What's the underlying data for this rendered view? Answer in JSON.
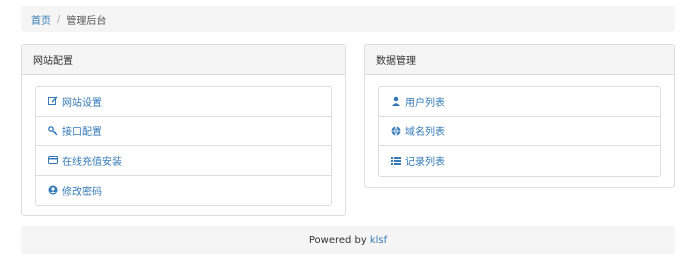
{
  "breadcrumb": {
    "home": "首页",
    "separator": "/",
    "current": "管理后台"
  },
  "left_panel": {
    "title": "网站配置",
    "items": [
      {
        "label": "网站设置",
        "icon": "edit-icon"
      },
      {
        "label": "接口配置",
        "icon": "key-icon"
      },
      {
        "label": "在线充值安装",
        "icon": "credit-card-icon"
      },
      {
        "label": "修改密码",
        "icon": "user-circle-icon"
      }
    ]
  },
  "right_panel": {
    "title": "数据管理",
    "items": [
      {
        "label": "用户列表",
        "icon": "user-icon"
      },
      {
        "label": "域名列表",
        "icon": "globe-icon"
      },
      {
        "label": "记录列表",
        "icon": "list-icon"
      }
    ]
  },
  "footer": {
    "text": "Powered by",
    "link": "klsf"
  },
  "colors": {
    "link": "#337ab7",
    "panel_bg": "#f5f5f5",
    "border": "#dddddd"
  }
}
